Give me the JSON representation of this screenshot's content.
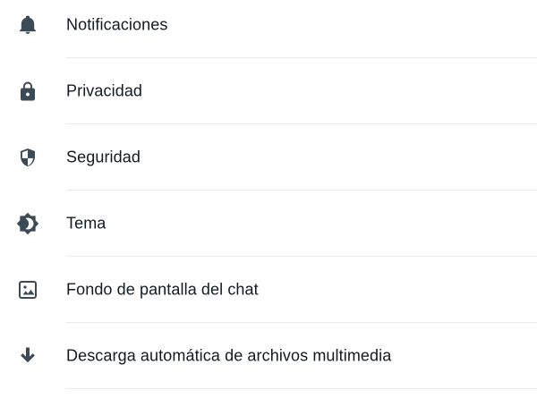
{
  "settings": {
    "items": [
      {
        "label": "Notificaciones",
        "icon": "bell-icon"
      },
      {
        "label": "Privacidad",
        "icon": "lock-icon"
      },
      {
        "label": "Seguridad",
        "icon": "shield-icon"
      },
      {
        "label": "Tema",
        "icon": "theme-icon"
      },
      {
        "label": "Fondo de pantalla del chat",
        "icon": "wallpaper-icon"
      },
      {
        "label": "Descarga automática de archivos multimedia",
        "icon": "download-icon"
      }
    ]
  },
  "colors": {
    "icon": "#3b4a54",
    "text": "#111b21",
    "divider": "#e9edef",
    "background": "#ffffff"
  }
}
